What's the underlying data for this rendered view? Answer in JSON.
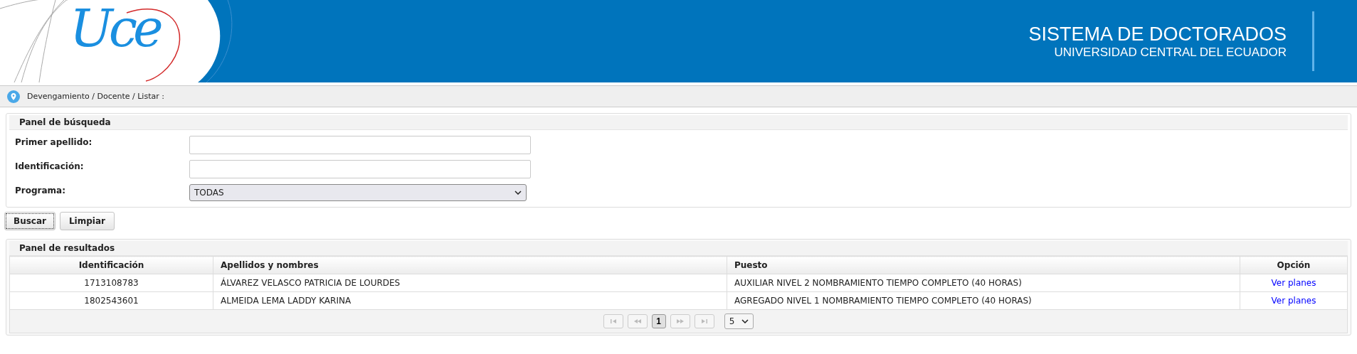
{
  "header": {
    "logo_text": "Uce",
    "title": "SISTEMA DE DOCTORADOS",
    "subtitle": "UNIVERSIDAD CENTRAL DEL ECUADOR"
  },
  "breadcrumb": "Devengamiento / Docente / Listar :",
  "search_panel": {
    "title": "Panel de búsqueda",
    "fields": [
      {
        "label": "Primer apellido:",
        "kind": "text"
      },
      {
        "label": "Identificación:",
        "kind": "text"
      },
      {
        "label": "Programa:",
        "kind": "select",
        "value": "TODAS"
      }
    ]
  },
  "buttons": [
    {
      "label": "Buscar",
      "focused": true
    },
    {
      "label": "Limpiar",
      "focused": false
    }
  ],
  "results_panel": {
    "title": "Panel de resultados",
    "table": {
      "columns": [
        "Identificación",
        "Apellidos y nombres",
        "Puesto",
        "Opción"
      ],
      "rows": [
        [
          "1713108783",
          "ÁLVAREZ VELASCO PATRICIA DE LOURDES",
          "AUXILIAR NIVEL 2 NOMBRAMIENTO TIEMPO COMPLETO (40 HORAS)",
          "Ver planes"
        ],
        [
          "1802543601",
          "ALMEIDA LEMA LADDY KARINA",
          "AGREGADO NIVEL 1 NOMBRAMIENTO TIEMPO COMPLETO (40 HORAS)",
          "Ver planes"
        ]
      ]
    },
    "pagination": {
      "nav_before": [
        {
          "kind": "first",
          "disabled": true
        },
        {
          "kind": "prev",
          "disabled": true
        }
      ],
      "pages": [
        {
          "label": "1",
          "selected": true
        }
      ],
      "nav_after": [
        {
          "kind": "next",
          "disabled": true
        },
        {
          "kind": "last",
          "disabled": true
        }
      ],
      "page_size": "5"
    }
  }
}
